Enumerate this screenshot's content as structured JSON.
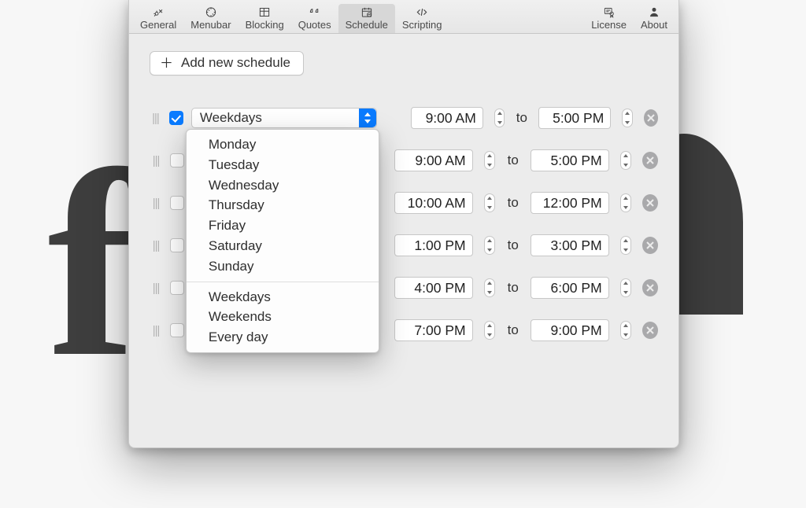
{
  "toolbar": {
    "items": [
      {
        "label": "General"
      },
      {
        "label": "Menubar"
      },
      {
        "label": "Blocking"
      },
      {
        "label": "Quotes"
      },
      {
        "label": "Schedule"
      },
      {
        "label": "Scripting"
      }
    ],
    "right": [
      {
        "label": "License"
      },
      {
        "label": "About"
      }
    ],
    "selected_index": 4
  },
  "add_button": {
    "label": "Add new schedule"
  },
  "to_label": "to",
  "schedules": [
    {
      "checked": true,
      "day": "Weekdays",
      "from": "9:00 AM",
      "to": "5:00 PM"
    },
    {
      "checked": false,
      "day": "",
      "from": "9:00 AM",
      "to": "5:00 PM"
    },
    {
      "checked": false,
      "day": "",
      "from": "10:00 AM",
      "to": "12:00 PM"
    },
    {
      "checked": false,
      "day": "",
      "from": "1:00 PM",
      "to": "3:00 PM"
    },
    {
      "checked": false,
      "day": "",
      "from": "4:00 PM",
      "to": "6:00 PM"
    },
    {
      "checked": false,
      "day": "",
      "from": "7:00 PM",
      "to": "9:00 PM"
    }
  ],
  "dropdown": {
    "options_a": [
      "Monday",
      "Tuesday",
      "Wednesday",
      "Thursday",
      "Friday",
      "Saturday",
      "Sunday"
    ],
    "options_b": [
      "Weekdays",
      "Weekends",
      "Every day"
    ]
  }
}
